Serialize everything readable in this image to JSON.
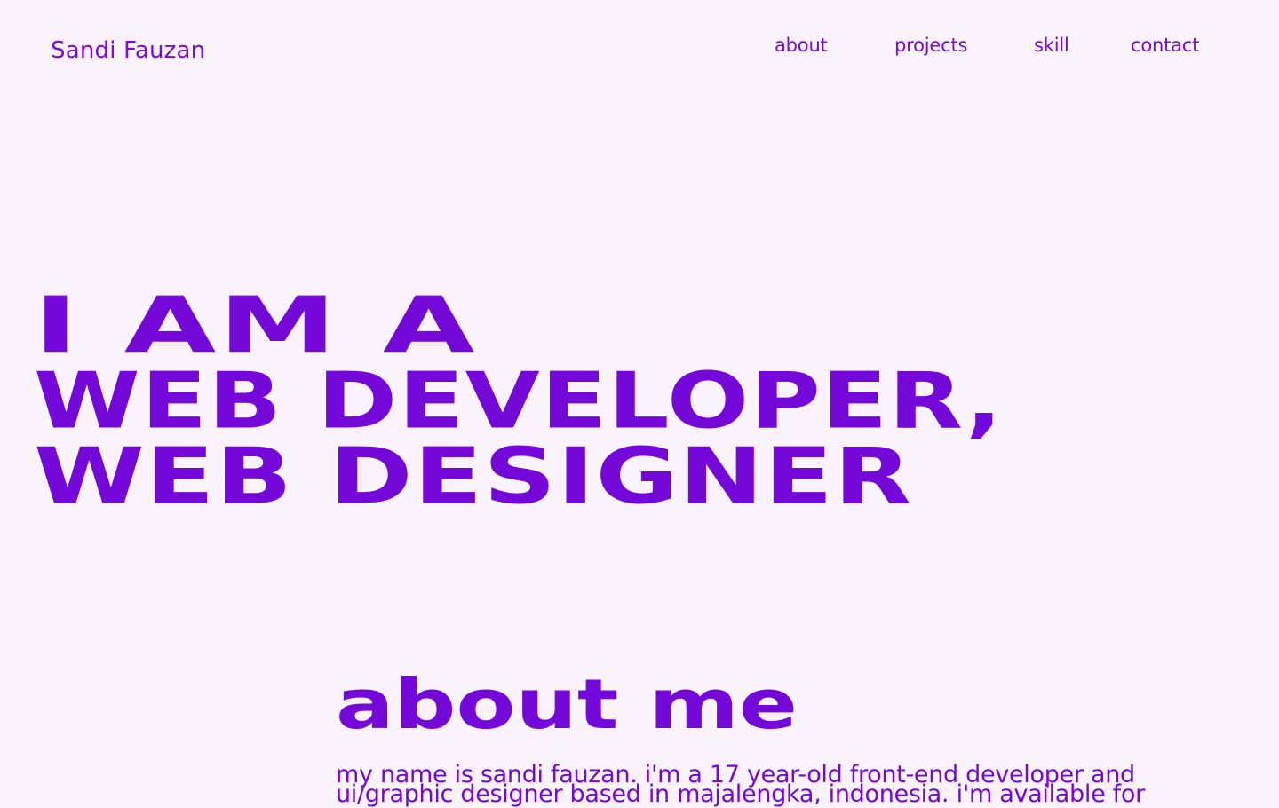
{
  "header": {
    "logo_text": "Sandi Fauzan",
    "nav": [
      {
        "label": "about"
      },
      {
        "label": "projects"
      },
      {
        "label": "skill"
      },
      {
        "label": "contact"
      }
    ]
  },
  "hero": {
    "line1": "I AM A",
    "line2": "WEB DEVELOPER,",
    "line3": "WEB DESIGNER"
  },
  "about": {
    "title": "about me",
    "paragraph": "my name is sandi fauzan. i'm a 17 year-old front-end developer and ui/graphic designer based in majalengka, indonesia. i'm available for"
  },
  "colors": {
    "background": "#FAF3FD",
    "accent": "#7308D9"
  }
}
